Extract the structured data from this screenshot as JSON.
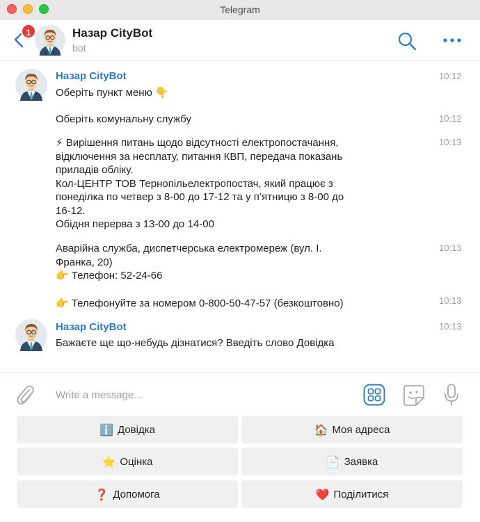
{
  "window": {
    "title": "Telegram"
  },
  "header": {
    "unread_count": "1",
    "name": "Назар CityBot",
    "subtitle": "bot"
  },
  "messages": [
    {
      "sender": "Назар CityBot",
      "text": "Оберіть пункт меню 👇",
      "time": "10:12"
    },
    {
      "text": "Оберіть комунальну службу",
      "time": "10:12"
    },
    {
      "text": "⚡ Вирішення питань щодо відсутності електропостачання,\nвідключення за несплату, питання КВП, передача показань\nприладів обліку.\nКол-ЦЕНТР ТОВ Тернопільелектропостач, який працює з\nпонеділка по четвер з 8-00 до 17-12 та у п’ятницю з 8-00 до\n16-12.\nОбідня перерва з 13-00 до 14-00",
      "time": "10:13"
    },
    {
      "text": "Аварійна служба, диспетчерська електромереж (вул. І.\nФранка, 20)\n👉 Телефон: 52-24-66",
      "time": "10:13"
    },
    {
      "text": "👉 Телефонуйте за номером 0-800-50-47-57 (безкоштовно)",
      "time": "10:13"
    },
    {
      "sender": "Назар CityBot",
      "text": "Бажаєте ще що-небудь дізнатися? Введіть слово Довідка",
      "time": "10:13"
    }
  ],
  "input": {
    "placeholder": "Write a message..."
  },
  "keyboard": [
    {
      "emoji": "ℹ️",
      "label": "Довідка"
    },
    {
      "emoji": "🏠",
      "label": "Моя адреса"
    },
    {
      "emoji": "⭐",
      "label": "Оцінка"
    },
    {
      "emoji": "📄",
      "label": "Заявка"
    },
    {
      "emoji": "❓",
      "label": "Допомога"
    },
    {
      "emoji": "❤️",
      "label": "Поділитися"
    }
  ],
  "colors": {
    "accent": "#2a7cc7",
    "badge": "#e53935",
    "key_background": "#f0f0f0"
  }
}
